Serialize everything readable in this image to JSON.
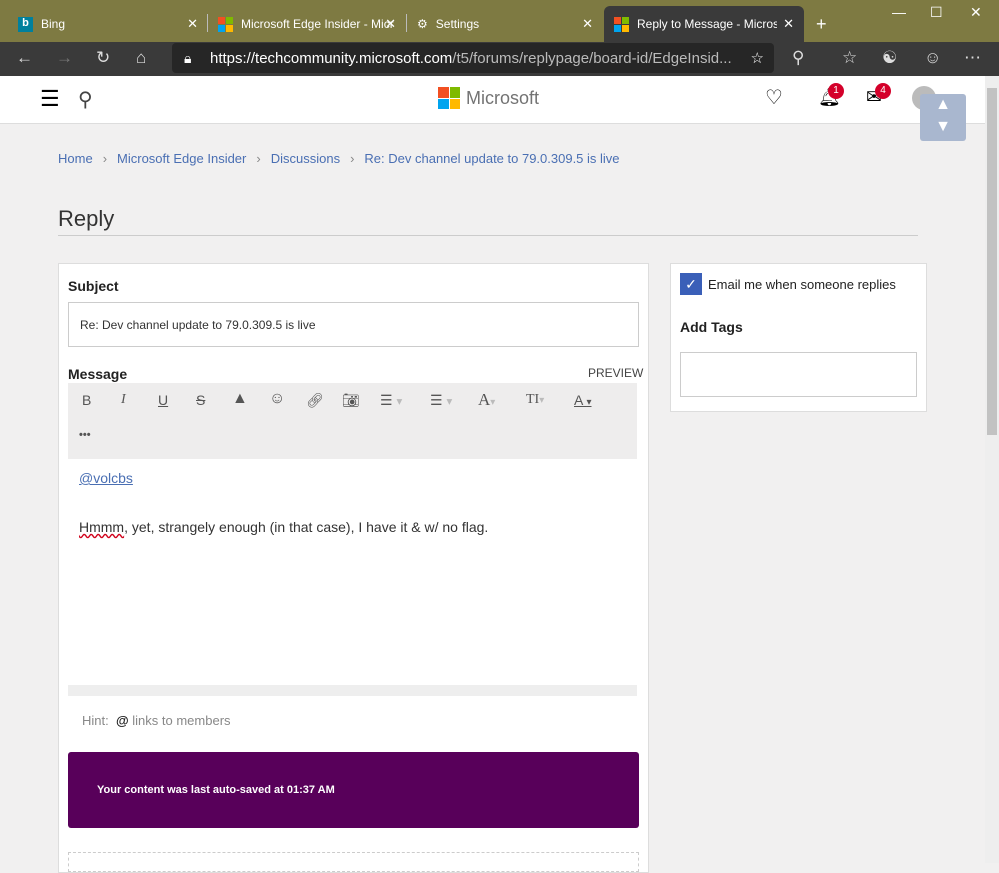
{
  "browser": {
    "tabs": [
      {
        "title": "Bing",
        "icon": "bing-icon"
      },
      {
        "title": "Microsoft Edge Insider - Micr",
        "icon": "microsoft-logo-icon"
      },
      {
        "title": "Settings",
        "icon": "gear-icon"
      },
      {
        "title": "Reply to Message - Microsoft",
        "icon": "microsoft-logo-icon",
        "active": true
      }
    ],
    "url_host": "https://techcommunity.microsoft.com",
    "url_path": "/t5/forums/replypage/board-id/EdgeInsid..."
  },
  "header": {
    "logo_text": "Microsoft",
    "notifications_count": "1",
    "messages_count": "4"
  },
  "breadcrumb": [
    "Home",
    "Microsoft Edge Insider",
    "Discussions",
    "Re: Dev channel update to 79.0.309.5 is live"
  ],
  "page_title": "Reply",
  "form": {
    "subject_label": "Subject",
    "subject_value": "Re: Dev channel update to 79.0.309.5 is live",
    "message_label": "Message",
    "preview_label": "PREVIEW",
    "more_label": "•••",
    "mention": "@volcbs",
    "body_first_word": "Hmmm",
    "body_rest": ", yet, strangely enough (in that case), I have it & w/ no flag.",
    "hint_label": "Hint:",
    "hint_at": "@",
    "hint_text": "links to members",
    "autosave": "Your content was last auto-saved at 01:37 AM"
  },
  "sidebar": {
    "email_label": "Email me when someone replies",
    "email_checked": true,
    "tags_label": "Add Tags",
    "tags_value": ""
  },
  "colors": {
    "accent": "#4a6fb3",
    "autosave_bg": "#58005a",
    "checkbox": "#3a5fb8",
    "tabbar": "#7e7a42"
  }
}
